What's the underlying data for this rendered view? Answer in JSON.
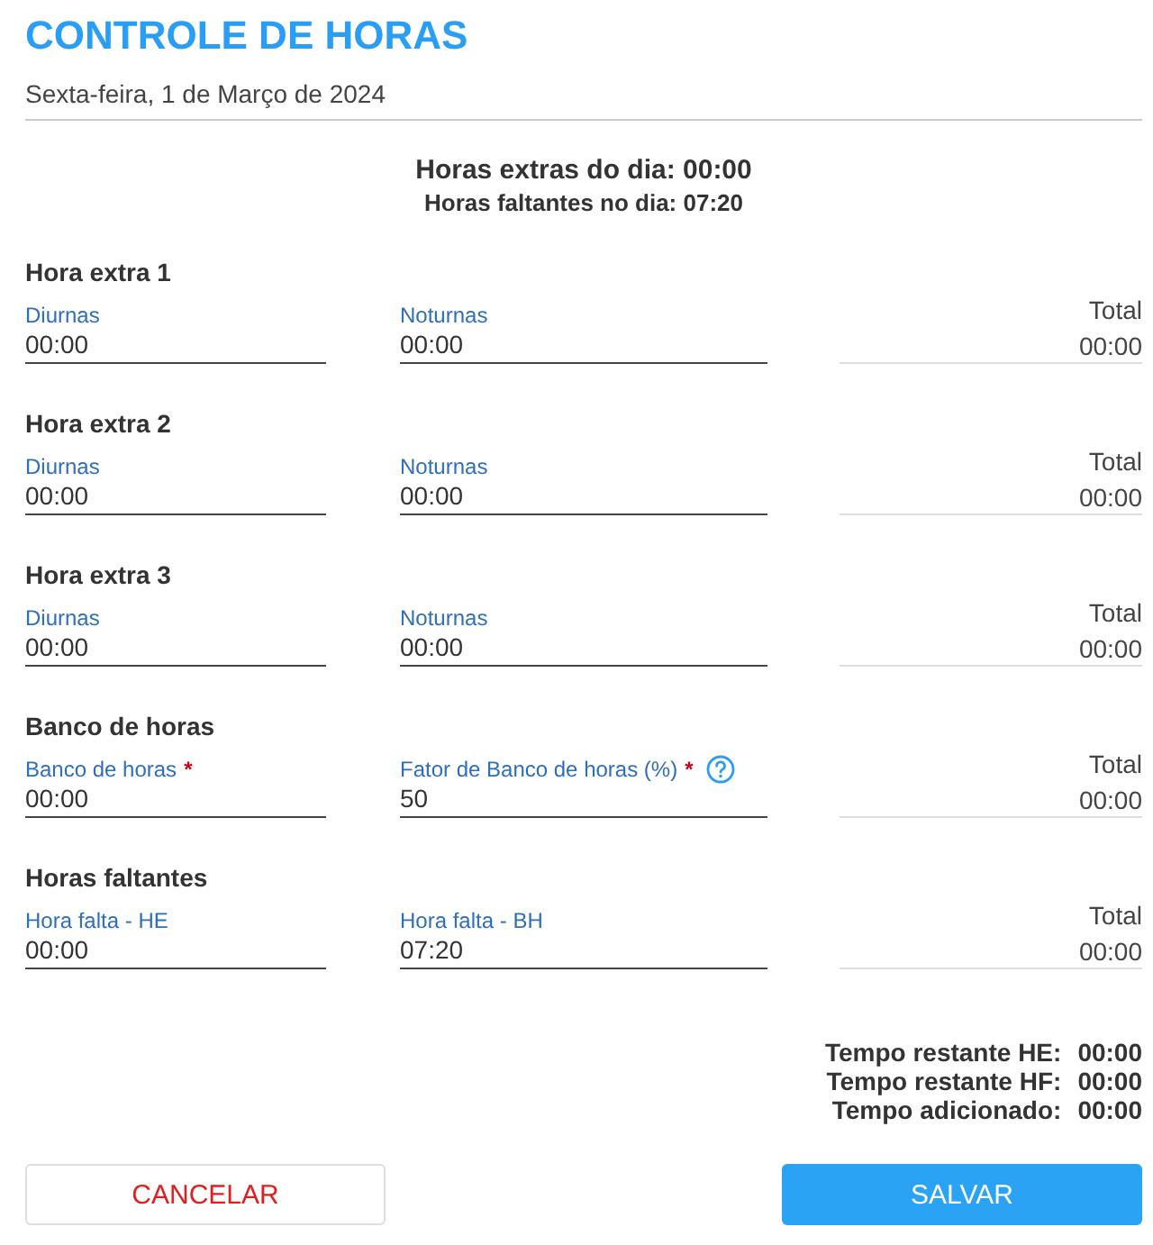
{
  "title": "CONTROLE DE HORAS",
  "date": "Sexta-feira, 1 de Março de 2024",
  "summary": [
    "Horas extras do dia: 00:00",
    "Horas faltantes no dia: 07:20"
  ],
  "sections": [
    {
      "title": "Hora extra 1",
      "fields": [
        {
          "label": "Diurnas",
          "value": "00:00",
          "help": false
        },
        {
          "label": "Noturnas",
          "value": "00:00",
          "help": false
        }
      ],
      "total_label": "Total",
      "total": "00:00"
    },
    {
      "title": "Hora extra 2",
      "fields": [
        {
          "label": "Diurnas",
          "value": "00:00",
          "help": false
        },
        {
          "label": "Noturnas",
          "value": "00:00",
          "help": false
        }
      ],
      "total_label": "Total",
      "total": "00:00"
    },
    {
      "title": "Hora extra 3",
      "fields": [
        {
          "label": "Diurnas",
          "value": "00:00",
          "help": false
        },
        {
          "label": "Noturnas",
          "value": "00:00",
          "help": false
        }
      ],
      "total_label": "Total",
      "total": "00:00"
    },
    {
      "title": "Banco de horas",
      "fields": [
        {
          "label": "Banco de horas",
          "value": "00:00",
          "required_mark": "*",
          "help": false
        },
        {
          "label": "Fator de Banco de horas (%)",
          "value": "50",
          "required_mark": "*",
          "help": true
        }
      ],
      "total_label": "Total",
      "total": "00:00"
    },
    {
      "title": "Horas faltantes",
      "fields": [
        {
          "label": "Hora falta - HE",
          "value": "00:00",
          "help": false
        },
        {
          "label": "Hora falta - BH",
          "value": "07:20",
          "help": false
        }
      ],
      "total_label": "Total",
      "total": "00:00"
    }
  ],
  "totals": [
    {
      "label": "Tempo restante HE:",
      "value": "00:00"
    },
    {
      "label": "Tempo restante HF:",
      "value": "00:00"
    },
    {
      "label": "Tempo adicionado:",
      "value": "00:00"
    }
  ],
  "buttons": [
    {
      "label": "CANCELAR",
      "kind": "secondary"
    },
    {
      "label": "SALVAR",
      "kind": "primary"
    }
  ]
}
